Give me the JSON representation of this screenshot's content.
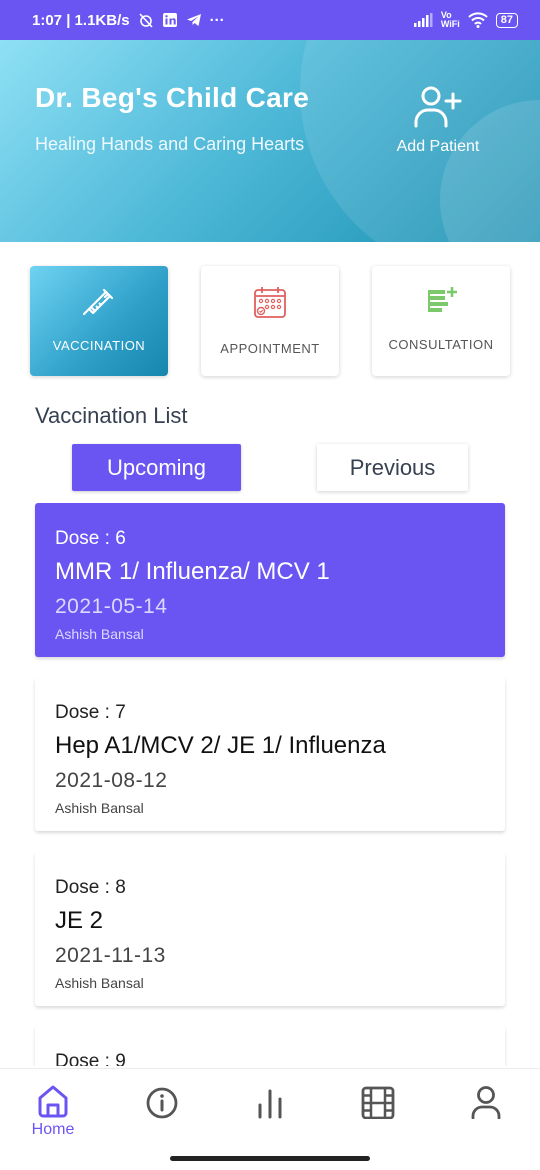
{
  "status_bar": {
    "time_speed": "1:07 | 1.1KB/s",
    "dots": "···",
    "network_label": "Vo\nWiFi",
    "battery": "87"
  },
  "header": {
    "title": "Dr. Beg's Child Care",
    "subtitle": "Healing Hands and Caring Hearts",
    "add_patient_label": "Add Patient"
  },
  "categories": [
    {
      "label": "VACCINATION",
      "icon": "syringe-icon",
      "active": true
    },
    {
      "label": "APPOINTMENT",
      "icon": "calendar-icon",
      "active": false
    },
    {
      "label": "CONSULTATION",
      "icon": "note-add-icon",
      "active": false
    }
  ],
  "vaccination": {
    "section_title": "Vaccination List",
    "tabs": {
      "upcoming": "Upcoming",
      "previous": "Previous"
    },
    "selected_tab": "Upcoming",
    "doses": [
      {
        "dose": "Dose : 6",
        "name": "MMR 1/ Influenza/ MCV 1",
        "date": "2021-05-14",
        "doctor": "Ashish Bansal",
        "highlighted": true
      },
      {
        "dose": "Dose : 7",
        "name": "Hep A1/MCV 2/ JE 1/ Influenza",
        "date": "2021-08-12",
        "doctor": "Ashish Bansal",
        "highlighted": false
      },
      {
        "dose": "Dose : 8",
        "name": "JE 2",
        "date": "2021-11-13",
        "doctor": "Ashish Bansal",
        "highlighted": false
      },
      {
        "dose": "Dose : 9",
        "name": "",
        "date": "",
        "doctor": "",
        "highlighted": false
      }
    ]
  },
  "bottom_nav": {
    "items": [
      {
        "label": "Home",
        "icon": "home-icon",
        "active": true
      },
      {
        "label": "",
        "icon": "info-icon",
        "active": false
      },
      {
        "label": "",
        "icon": "bar-chart-icon",
        "active": false
      },
      {
        "label": "",
        "icon": "film-icon",
        "active": false
      },
      {
        "label": "",
        "icon": "profile-icon",
        "active": false
      }
    ]
  },
  "colors": {
    "primary": "#6b55f2",
    "header_gradient_start": "#8fe0f5",
    "header_gradient_end": "#1a8fb2",
    "appointment_icon": "#e0605f",
    "consultation_icon": "#7bc96a"
  }
}
